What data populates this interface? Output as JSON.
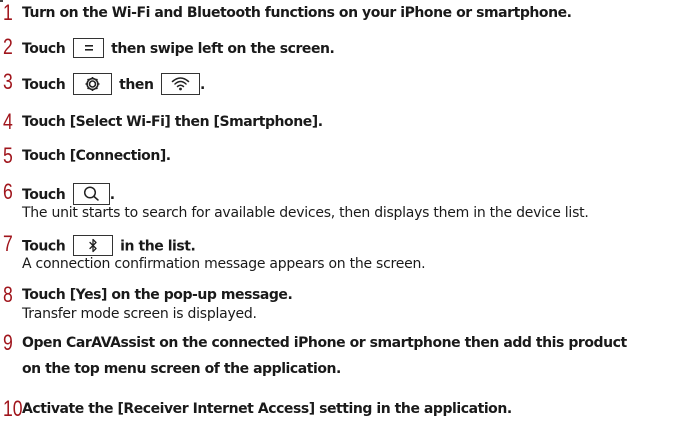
{
  "steps": [
    {
      "num": "1",
      "text": "Turn on the Wi-Fi and Bluetooth functions on your iPhone or smartphone."
    },
    {
      "num": "2",
      "pre": "Touch",
      "post": "then swipe left on the screen.",
      "icon": "menu-icon"
    },
    {
      "num": "3",
      "pre": "Touch",
      "mid": "then",
      "post": ".",
      "icon1": "gear-icon",
      "icon2": "wifi-icon"
    },
    {
      "num": "4",
      "text": "Touch [Select Wi-Fi] then [Smartphone]."
    },
    {
      "num": "5",
      "text": "Touch [Connection]."
    },
    {
      "num": "6",
      "pre": "Touch",
      "post": ".",
      "icon": "search-icon",
      "sub": "The unit starts to search for available devices, then displays them in the device list."
    },
    {
      "num": "7",
      "pre": "Touch",
      "post": "in the list.",
      "icon": "bluetooth-icon",
      "sub": "A connection confirmation message appears on the screen."
    },
    {
      "num": "8",
      "text": "Touch [Yes] on the pop-up message.",
      "sub": "Transfer mode screen is displayed."
    },
    {
      "num": "9",
      "text": "Open CarAVAssist on the connected iPhone or smartphone then add this product",
      "text2": "on the top menu screen of the application."
    },
    {
      "num": "10",
      "text": "Activate the [Receiver Internet Access] setting in the application."
    }
  ]
}
